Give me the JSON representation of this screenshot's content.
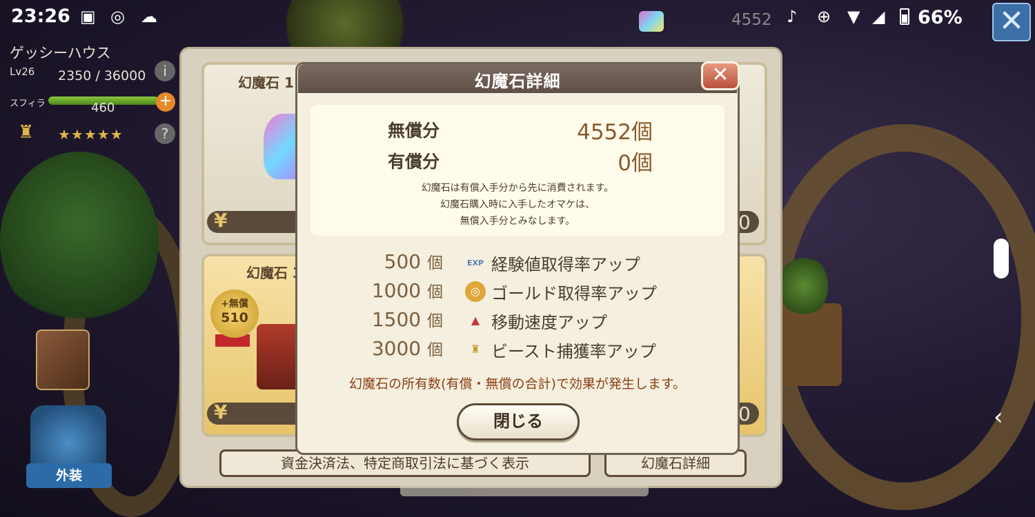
{
  "status_bar": {
    "time": "23:26",
    "battery": "66%",
    "gem_count": "4552"
  },
  "player": {
    "name": "ゲッシーハウス",
    "level": "Lv26",
    "exp": "2350 / 36000",
    "sphira_label": "スフィラ",
    "sphira_value": "460",
    "stars": "★★★★★"
  },
  "side": {
    "costume_label": "外装"
  },
  "shop": {
    "card1_title": "幻魔石 1",
    "card2_title": "幻魔石 30",
    "badge_top": "+無償",
    "badge_num": "510",
    "yen": "¥",
    "price_tail": "0",
    "legal_button": "資金決済法、特定商取引法に基づく表示",
    "detail_button": "幻魔石詳細"
  },
  "dialog": {
    "title": "幻魔石詳細",
    "close_icon": "✕",
    "free_label": "無償分",
    "free_value": "4552個",
    "paid_label": "有償分",
    "paid_value": "0個",
    "notes": [
      "幻魔石は有償入手分から先に消費されます。",
      "幻魔石購入時に入手したオマケは、",
      "無償入手分とみなします。"
    ],
    "bonuses": [
      {
        "count": "500",
        "unit": "個",
        "icon": "exp-icon",
        "icon_text": "EXP",
        "text": "経験値取得率アップ"
      },
      {
        "count": "1000",
        "unit": "個",
        "icon": "gold-coin-icon",
        "icon_text": "◎",
        "text": "ゴールド取得率アップ"
      },
      {
        "count": "1500",
        "unit": "個",
        "icon": "boot-icon",
        "icon_text": "▲",
        "text": "移動速度アップ"
      },
      {
        "count": "3000",
        "unit": "個",
        "icon": "lamp-icon",
        "icon_text": "♜",
        "text": "ビースト捕獲率アップ"
      }
    ],
    "footnote": "幻魔石の所有数(有償・無償の合計)で効果が発生します。",
    "close_button": "閉じる"
  }
}
